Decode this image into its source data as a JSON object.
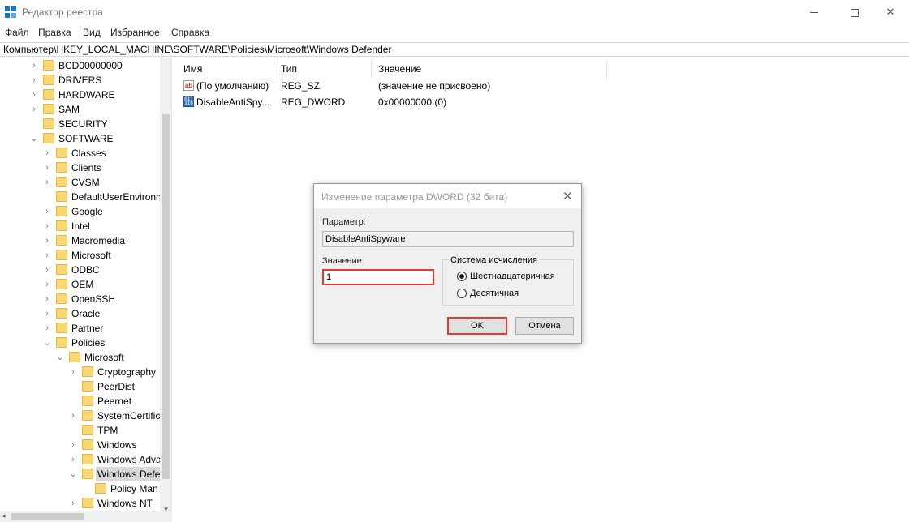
{
  "window": {
    "title": "Редактор реестра",
    "controls": {
      "minimize": "—",
      "close": "✕"
    }
  },
  "menu": [
    "Файл",
    "Правка",
    "Вид",
    "Избранное",
    "Справка"
  ],
  "address": "Компьютер\\HKEY_LOCAL_MACHINE\\SOFTWARE\\Policies\\Microsoft\\Windows Defender",
  "tree": {
    "items": [
      {
        "label": "BCD00000000",
        "chevron": "›"
      },
      {
        "label": "DRIVERS",
        "chevron": "›"
      },
      {
        "label": "HARDWARE",
        "chevron": "›"
      },
      {
        "label": "SAM",
        "chevron": "›"
      },
      {
        "label": "SECURITY",
        "chevron": ""
      },
      {
        "label": "SOFTWARE",
        "chevron": "⌄"
      },
      {
        "label": "Classes",
        "chevron": "›"
      },
      {
        "label": "Clients",
        "chevron": "›"
      },
      {
        "label": "CVSM",
        "chevron": "›"
      },
      {
        "label": "DefaultUserEnvironn",
        "chevron": ""
      },
      {
        "label": "Google",
        "chevron": "›"
      },
      {
        "label": "Intel",
        "chevron": "›"
      },
      {
        "label": "Macromedia",
        "chevron": "›"
      },
      {
        "label": "Microsoft",
        "chevron": "›"
      },
      {
        "label": "ODBC",
        "chevron": "›"
      },
      {
        "label": "OEM",
        "chevron": "›"
      },
      {
        "label": "OpenSSH",
        "chevron": "›"
      },
      {
        "label": "Oracle",
        "chevron": "›"
      },
      {
        "label": "Partner",
        "chevron": "›"
      },
      {
        "label": "Policies",
        "chevron": "⌄"
      },
      {
        "label": "Microsoft",
        "chevron": "⌄"
      },
      {
        "label": "Cryptography",
        "chevron": "›"
      },
      {
        "label": "PeerDist",
        "chevron": ""
      },
      {
        "label": "Peernet",
        "chevron": ""
      },
      {
        "label": "SystemCertific",
        "chevron": "›"
      },
      {
        "label": "TPM",
        "chevron": ""
      },
      {
        "label": "Windows",
        "chevron": "›"
      },
      {
        "label": "Windows Adva",
        "chevron": "›"
      },
      {
        "label": "Windows Defe",
        "chevron": "⌄"
      },
      {
        "label": "Policy Man",
        "chevron": ""
      },
      {
        "label": "Windows NT",
        "chevron": "›"
      }
    ],
    "scroll_down": "▾",
    "scroll_left": "◂"
  },
  "list": {
    "columns": [
      "Имя",
      "Тип",
      "Значение"
    ],
    "rows": [
      {
        "icon": "string-value-icon",
        "icon_text": "ab",
        "name": "(По умолчанию)",
        "type": "REG_SZ",
        "data": "(значение не присвоено)"
      },
      {
        "icon": "dword-value-icon",
        "icon_text": "011\n110",
        "name": "DisableAntiSpy...",
        "type": "REG_DWORD",
        "data": "0x00000000 (0)"
      }
    ]
  },
  "dialog": {
    "title": "Изменение параметра DWORD (32 бита)",
    "close": "✕",
    "param_label": "Параметр:",
    "param_value": "DisableAntiSpyware",
    "value_label": "Значение:",
    "value": "1",
    "radix_label": "Система исчисления",
    "radix_options": [
      {
        "label": "Шестнадцатеричная",
        "selected": true
      },
      {
        "label": "Десятичная",
        "selected": false
      }
    ],
    "ok": "OK",
    "cancel": "Отмена"
  },
  "colors": {
    "highlight": "#e03c2c",
    "folder": "#f8d775",
    "app_icon": "#1a78c2"
  }
}
